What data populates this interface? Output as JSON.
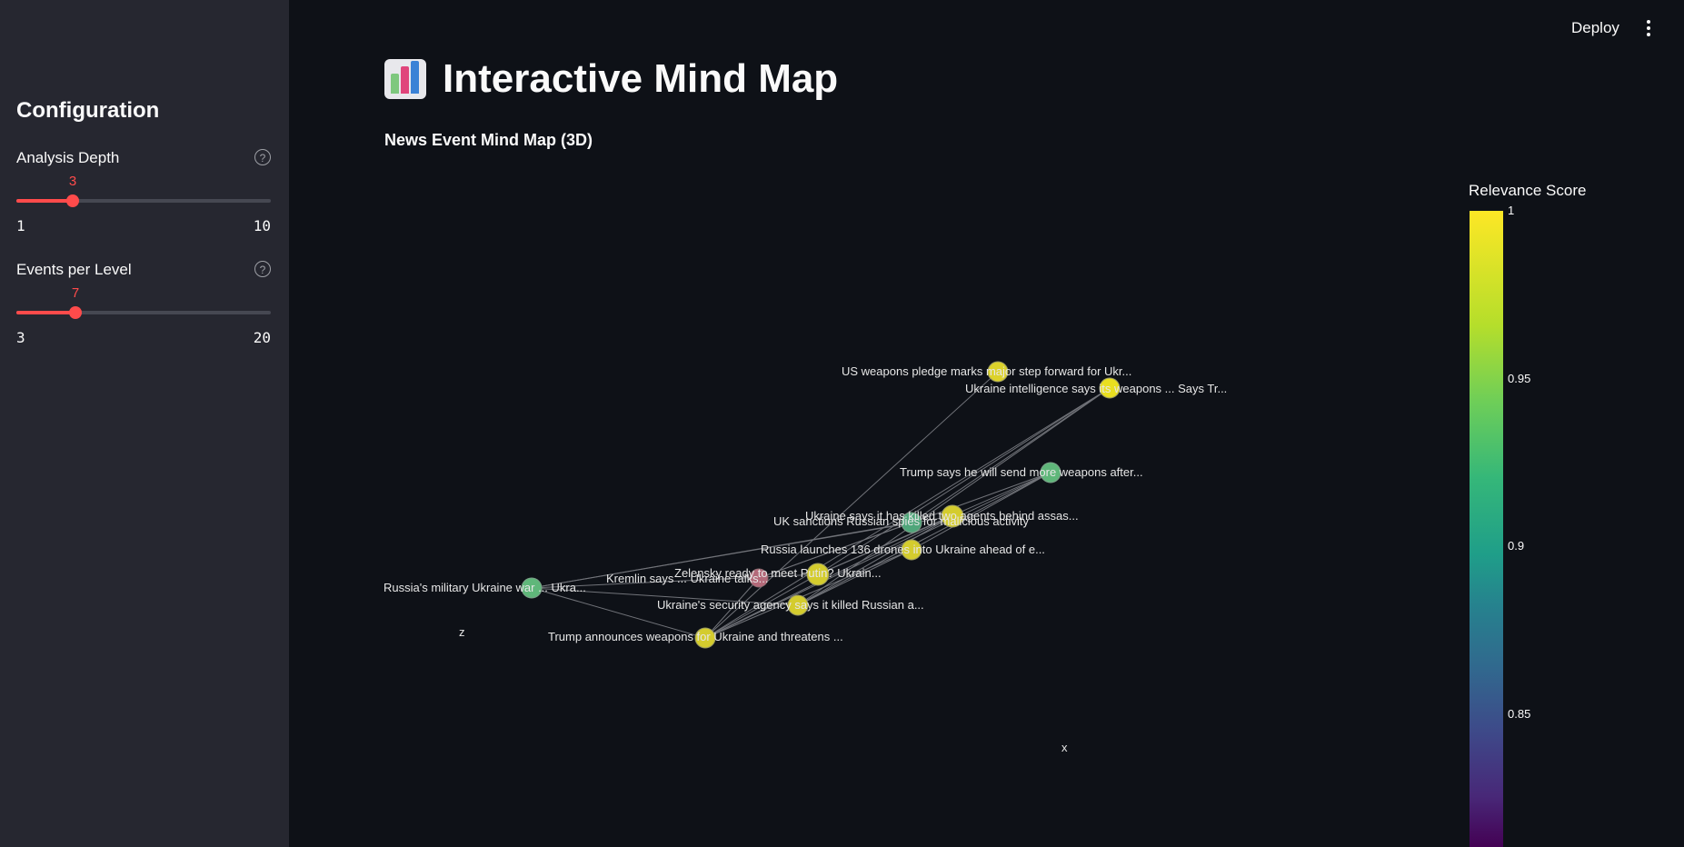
{
  "sidebar": {
    "title": "Configuration",
    "sliders": [
      {
        "label": "Analysis Depth",
        "value": "3",
        "min": "1",
        "max": "10",
        "fraction": 0.222
      },
      {
        "label": "Events per Level",
        "value": "7",
        "min": "3",
        "max": "20",
        "fraction": 0.235
      }
    ]
  },
  "header": {
    "deploy_label": "Deploy"
  },
  "main": {
    "title": "Interactive Mind Map",
    "subtitle": "News Event Mind Map (3D)"
  },
  "plot": {
    "axis_z": "z",
    "axis_x": "x",
    "node_colors": {
      "yellow": "#dcd22a",
      "green": "#5fb77a",
      "pink": "#b46a7a"
    },
    "labels": [
      "US weapons pledge marks major step forward for Ukr...",
      "Ukraine intelligence says its weapons ... Says Tr...",
      "Trump says he will send more weapons after...",
      "Ukraine says it has killed two agents behind assas...",
      "UK sanctions Russian spies for malicious activity",
      "Russia launches 136 drones into Ukraine ahead of e...",
      "Zelensky ready to meet Putin? Ukrain...",
      "Kremlin says ... Ukraine talks...",
      "Russia's military Ukraine war ... Ukra...",
      "Ukraine's security agency says it killed Russian a...",
      "Trump announces weapons for Ukraine and threatens ..."
    ],
    "colorbar": {
      "title": "Relevance Score",
      "ticks": [
        "1",
        "0.95",
        "0.9",
        "0.85"
      ]
    }
  }
}
